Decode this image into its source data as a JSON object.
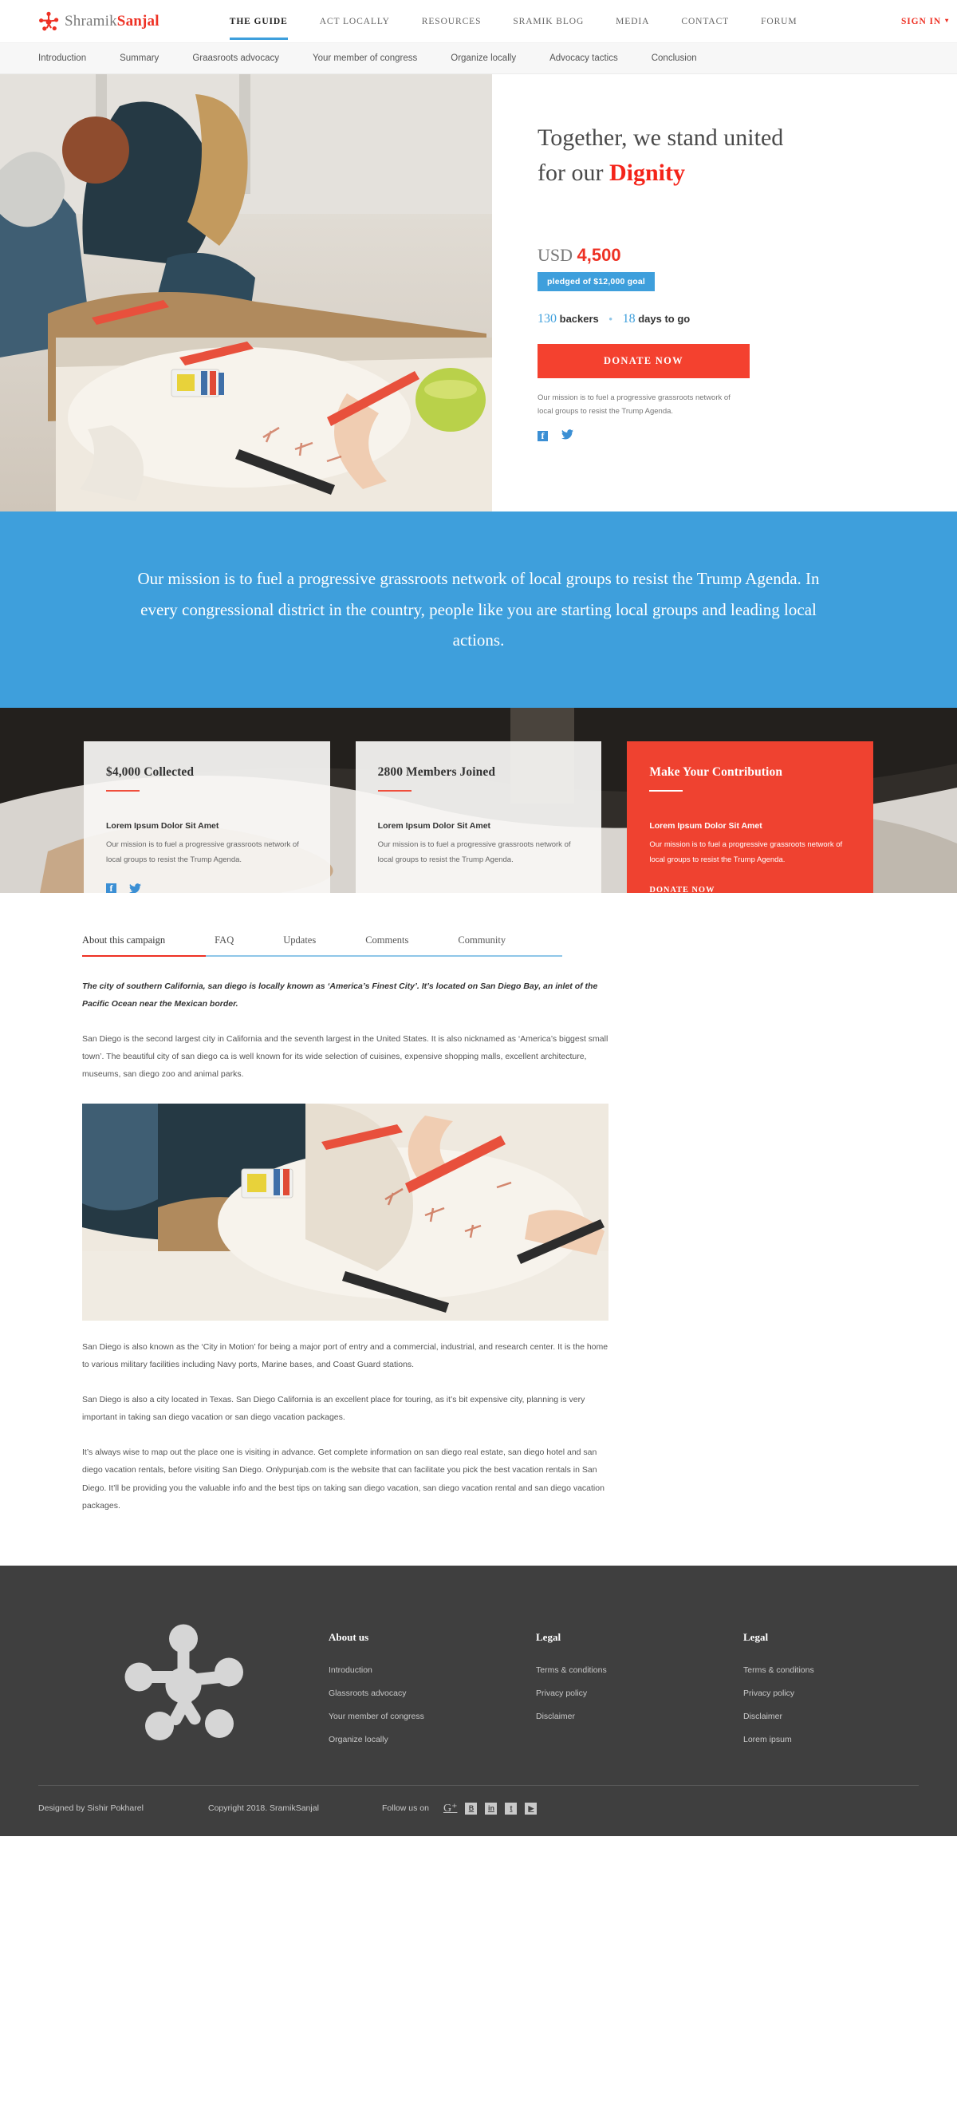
{
  "header": {
    "logo": {
      "icon": "network-star-icon",
      "text_light": "Shramik",
      "text_bold": "Sanjal"
    },
    "nav": [
      {
        "label": "THE GUIDE",
        "active": true
      },
      {
        "label": "ACT LOCALLY",
        "active": false
      },
      {
        "label": "RESOURCES",
        "active": false
      },
      {
        "label": "SRAMIK BLOG",
        "active": false
      },
      {
        "label": "MEDIA",
        "active": false
      },
      {
        "label": "CONTACT",
        "active": false
      },
      {
        "label": "FORUM",
        "active": false
      }
    ],
    "signin": {
      "label": "SIGN IN",
      "caret": "▾"
    }
  },
  "subnav": {
    "items": [
      {
        "label": "Introduction"
      },
      {
        "label": "Summary"
      },
      {
        "label": "Graasroots advocacy"
      },
      {
        "label": "Your member of congress"
      },
      {
        "label": "Organize locally"
      },
      {
        "label": "Advocacy tactics"
      },
      {
        "label": "Conclusion"
      }
    ]
  },
  "hero": {
    "title_line1": "Together, we stand united",
    "title_line2_pre": "for our ",
    "title_highlight": "Dignity",
    "currency": "USD",
    "amount": "4,500",
    "pledge_badge": "pledged of $12,000 goal",
    "backers_count": "130",
    "backers_label": "backers",
    "separator": "•",
    "days_count": "18",
    "days_label": "days to go",
    "donate_label": "DONATE NOW",
    "note": "Our mission is to fuel a progressive grassroots network of local groups to resist the Trump Agenda.",
    "social": [
      {
        "name": "facebook-icon"
      },
      {
        "name": "twitter-icon"
      }
    ]
  },
  "mission": {
    "text": "Our mission is to fuel a progressive grassroots network of local groups to resist the Trump Agenda. In every congressional district in the country, people like you are starting local groups and leading local actions."
  },
  "cards": [
    {
      "title": "$4,000 Collected",
      "subtitle": "Lorem Ipsum Dolor Sit Amet",
      "body": "Our mission is to fuel a progressive grassroots network of local groups to resist the Trump Agenda.",
      "style": "light",
      "has_social": true
    },
    {
      "title": "2800 Members Joined",
      "subtitle": "Lorem Ipsum Dolor Sit Amet",
      "body": "Our mission is to fuel a progressive grassroots network of local groups to resist the Trump Agenda.",
      "style": "light",
      "has_social": false
    },
    {
      "title": "Make Your Contribution",
      "subtitle": "Lorem Ipsum Dolor Sit Amet",
      "body": "Our mission is to fuel a progressive grassroots network of local groups to resist the Trump Agenda.",
      "style": "red",
      "link_label": "DONATE NOW",
      "has_social": false
    }
  ],
  "content": {
    "tabs": [
      {
        "label": "About this campaign",
        "active": true
      },
      {
        "label": "FAQ",
        "active": false
      },
      {
        "label": "Updates",
        "active": false
      },
      {
        "label": "Comments",
        "active": false
      },
      {
        "label": "Community",
        "active": false
      }
    ],
    "lede": "The city of southern California, san diego is locally known as ‘America’s Finest City’. It’s located on San Diego Bay, an inlet of the Pacific Ocean near the Mexican border.",
    "para1": "San Diego is the second largest city in California and the seventh largest in the United States. It is also nicknamed as ‘America’s biggest small town’. The beautiful city of san diego ca is well known for its wide selection of cuisines, expensive shopping malls, excellent architecture, museums, san diego zoo and animal parks.",
    "para2": "San Diego is also known as the ‘City in Motion’ for being a major port of entry and a commercial, industrial, and research center. It is the home to various military facilities including Navy ports, Marine bases, and Coast Guard stations.",
    "para3": "San Diego is also a city located in Texas. San Diego California is an excellent place for touring, as it’s bit expensive city, planning is very important in taking san diego vacation or san diego vacation packages.",
    "para4": "It’s always wise to map out the place one is visiting in advance. Get complete information on san diego real estate, san diego hotel and san diego vacation rentals, before visiting San Diego. Onlypunjab.com is the website that can facilitate you pick the best vacation rentals in San Diego. It’ll be providing you the valuable info and the best tips on taking san diego vacation, san diego vacation rental and san diego vacation packages."
  },
  "footer": {
    "logo_icon": "network-star-icon",
    "columns": [
      {
        "title": "About us",
        "links": [
          {
            "label": "Introduction"
          },
          {
            "label": "Glassroots advocacy"
          },
          {
            "label": "Your member of congress"
          },
          {
            "label": "Organize locally"
          }
        ]
      },
      {
        "title": "Legal",
        "links": [
          {
            "label": "Terms & conditions"
          },
          {
            "label": "Privacy policy"
          },
          {
            "label": "Disclaimer"
          }
        ]
      },
      {
        "title": "Legal",
        "links": [
          {
            "label": "Terms & conditions"
          },
          {
            "label": "Privacy policy"
          },
          {
            "label": "Disclaimer"
          },
          {
            "label": "Lorem ipsum"
          }
        ]
      }
    ],
    "designed_by": "Designed by Sishir Pokharel",
    "copyright": "Copyright 2018. SramikSanjal",
    "follow_label": "Follow us on",
    "social": [
      {
        "name": "google-plus-icon",
        "glyph": "G⁺"
      },
      {
        "name": "blogger-icon",
        "glyph": "B"
      },
      {
        "name": "linkedin-icon",
        "glyph": "in"
      },
      {
        "name": "twitter-icon",
        "glyph": "t"
      },
      {
        "name": "youtube-icon",
        "glyph": "▶"
      }
    ]
  },
  "colors": {
    "brand_red": "#ee3124",
    "accent_blue": "#3e9fdc",
    "footer_bg": "#3f3f3f",
    "card_red": "#ef4230"
  }
}
